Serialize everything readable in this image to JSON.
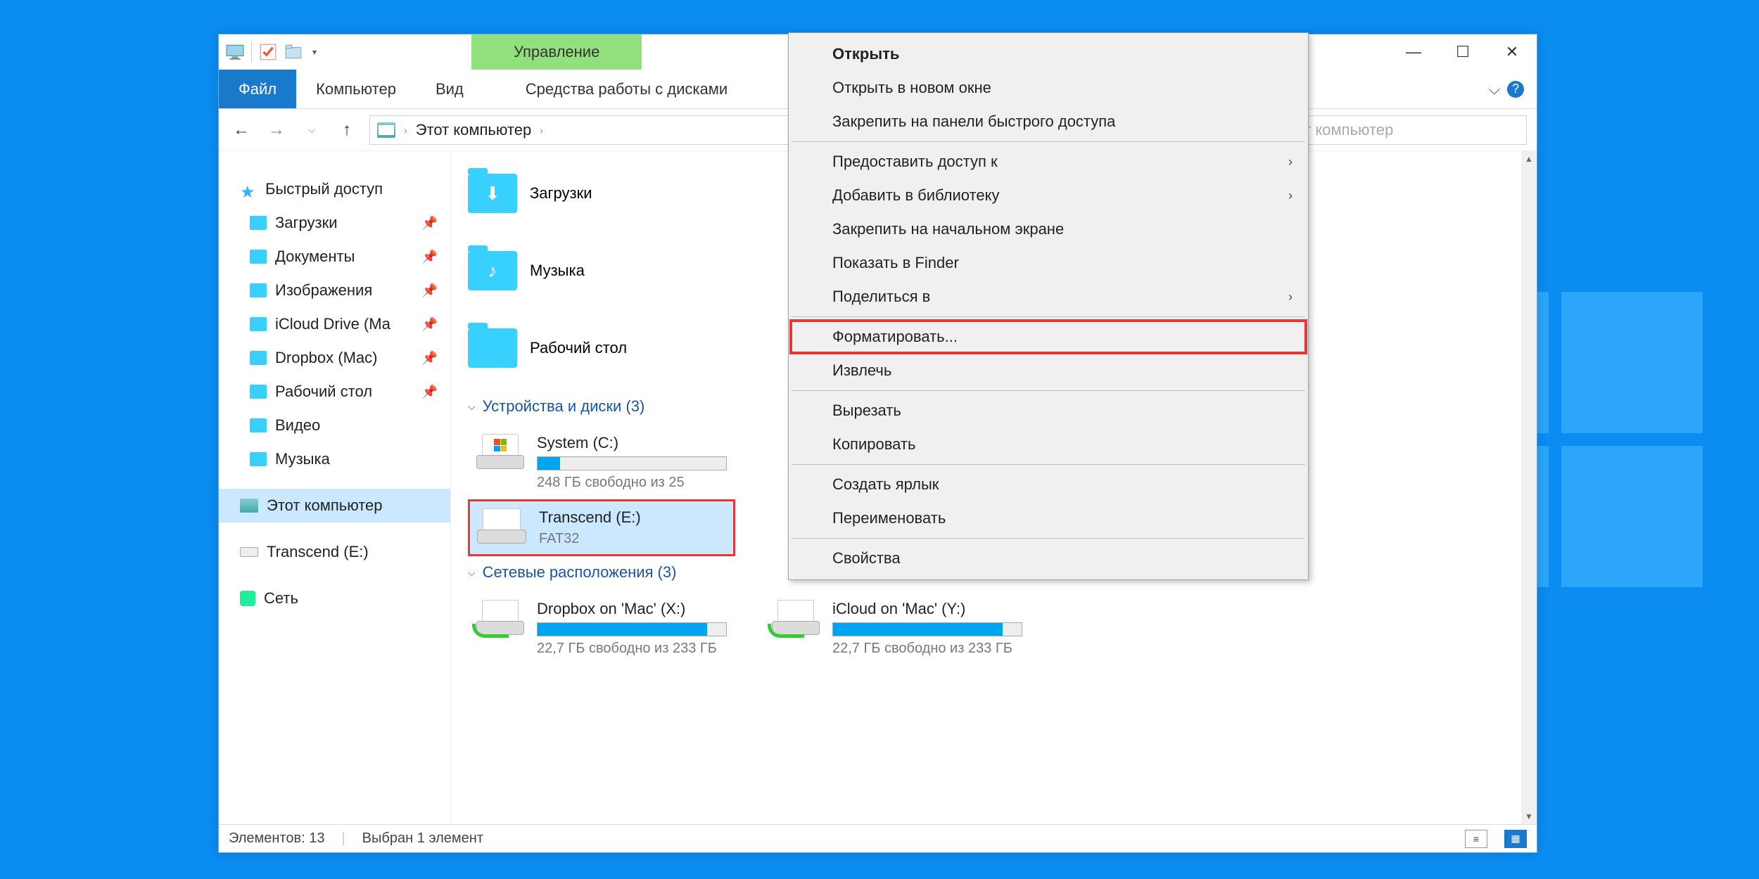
{
  "titlebar": {
    "contextual_group": "Управление"
  },
  "ribbon": {
    "file": "Файл",
    "tabs": [
      "Компьютер",
      "Вид"
    ],
    "contextual_tab": "Средства работы с дисками"
  },
  "breadcrumb": {
    "path": "Этот компьютер"
  },
  "search": {
    "placeholder": "ск: Этот компьютер"
  },
  "sidebar": {
    "quick_access": "Быстрый доступ",
    "items": [
      {
        "label": "Загрузки",
        "pinned": true
      },
      {
        "label": "Документы",
        "pinned": true
      },
      {
        "label": "Изображения",
        "pinned": true
      },
      {
        "label": "iCloud Drive (Ma",
        "pinned": true
      },
      {
        "label": "Dropbox (Mac)",
        "pinned": true
      },
      {
        "label": "Рабочий стол",
        "pinned": true
      },
      {
        "label": "Видео",
        "pinned": false
      },
      {
        "label": "Музыка",
        "pinned": false
      }
    ],
    "this_pc": "Этот компьютер",
    "transcend": "Transcend (E:)",
    "network": "Сеть"
  },
  "content": {
    "folders": [
      {
        "label": "Загрузки",
        "glyph": "⬇"
      },
      {
        "label": "Музыка",
        "glyph": "♪"
      },
      {
        "label": "Рабочий стол",
        "glyph": ""
      }
    ],
    "section_devices": "Устройства и диски (3)",
    "section_network": "Сетевые расположения (3)",
    "drives": [
      {
        "name": "System (C:)",
        "sub": "248 ГБ свободно из 25",
        "fill": 12,
        "winflag": true
      },
      {
        "name": "Transcend (E:)",
        "sub": "FAT32",
        "fill": 0,
        "selected": true
      }
    ],
    "network_drives": [
      {
        "name": "Dropbox on 'Mac' (X:)",
        "sub": "22,7 ГБ свободно из 233 ГБ",
        "fill": 90
      },
      {
        "name": "iCloud on 'Mac' (Y:)",
        "sub": "22,7 ГБ свободно из 233 ГБ",
        "fill": 90
      }
    ]
  },
  "statusbar": {
    "items": "Элементов: 13",
    "selected": "Выбран 1 элемент"
  },
  "context_menu": [
    {
      "label": "Открыть",
      "bold": true
    },
    {
      "label": "Открыть в новом окне"
    },
    {
      "label": "Закрепить на панели быстрого доступа"
    },
    {
      "sep": true
    },
    {
      "label": "Предоставить доступ к",
      "submenu": true
    },
    {
      "label": "Добавить в библиотеку",
      "submenu": true
    },
    {
      "label": "Закрепить на начальном экране"
    },
    {
      "label": "Показать в Finder"
    },
    {
      "label": "Поделиться в",
      "submenu": true
    },
    {
      "sep": true
    },
    {
      "label": "Форматировать...",
      "highlighted": true
    },
    {
      "label": "Извлечь"
    },
    {
      "sep": true
    },
    {
      "label": "Вырезать"
    },
    {
      "label": "Копировать"
    },
    {
      "sep": true
    },
    {
      "label": "Создать ярлык"
    },
    {
      "label": "Переименовать"
    },
    {
      "sep": true
    },
    {
      "label": "Свойства"
    }
  ]
}
